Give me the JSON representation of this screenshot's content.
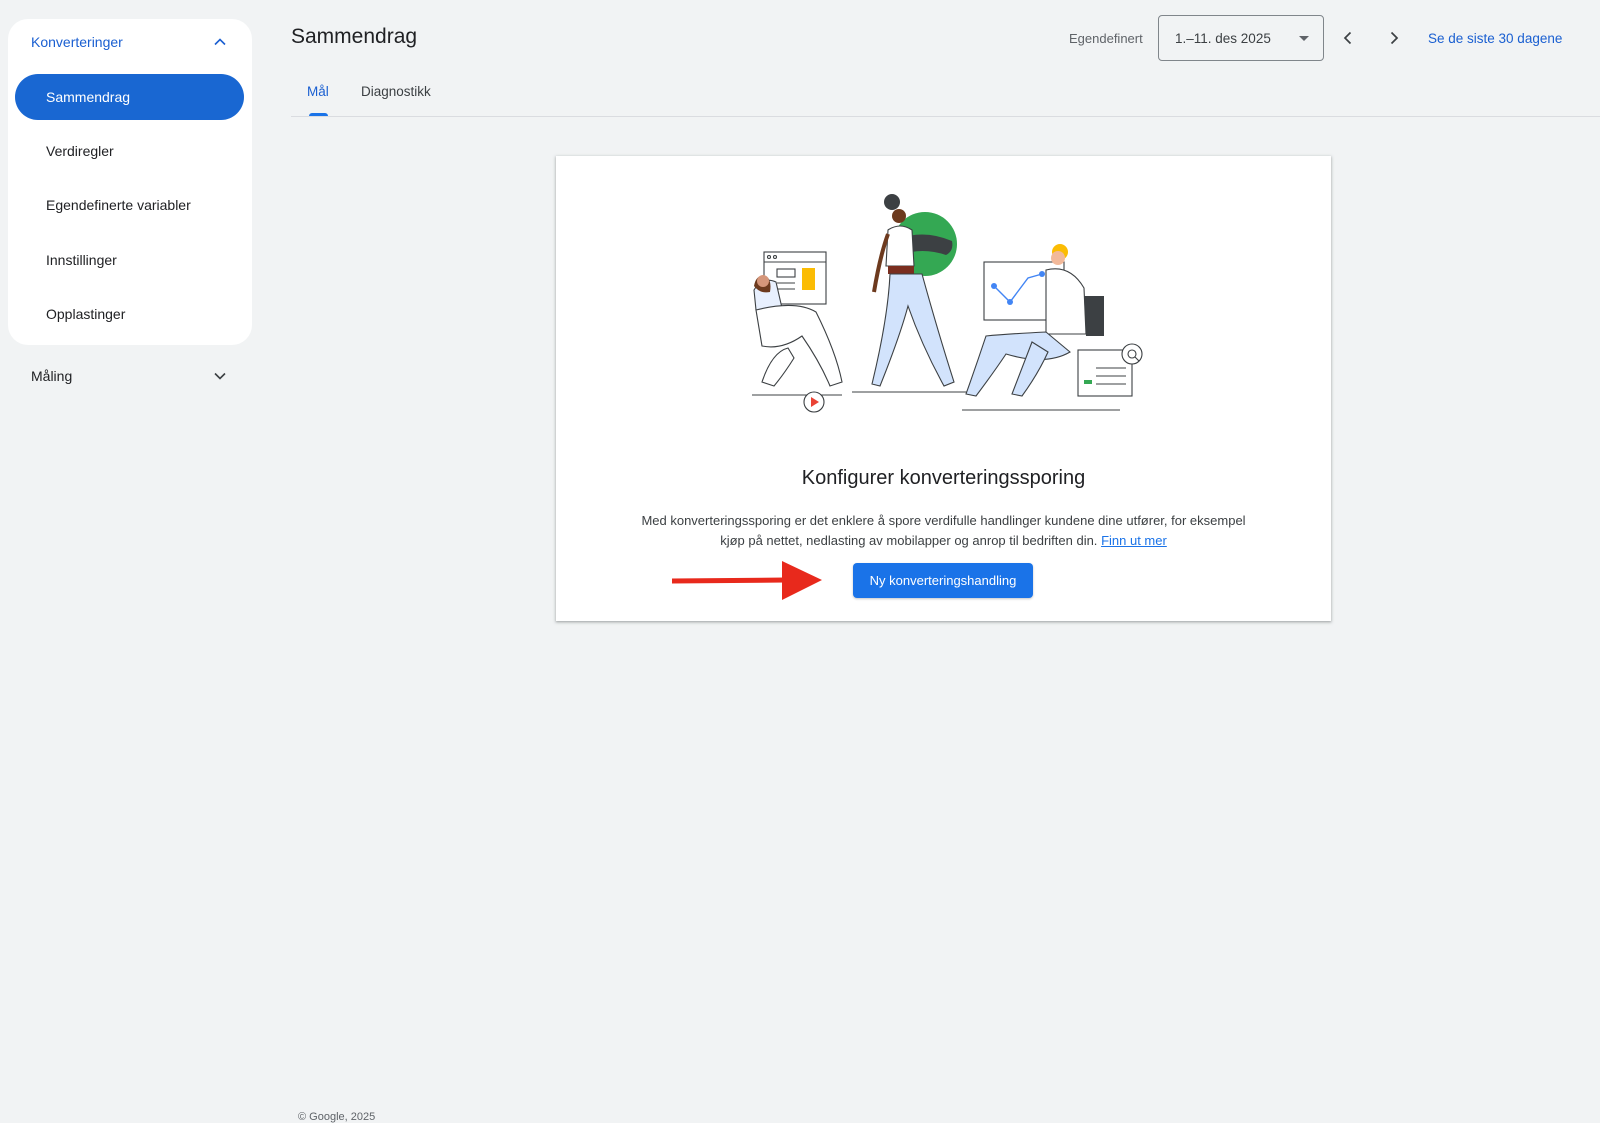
{
  "sidebar": {
    "group": {
      "label": "Konverteringer",
      "expanded": true
    },
    "items": [
      {
        "label": "Sammendrag",
        "active": true
      },
      {
        "label": "Verdiregler",
        "active": false
      },
      {
        "label": "Egendefinerte variabler",
        "active": false
      },
      {
        "label": "Innstillinger",
        "active": false
      },
      {
        "label": "Opplastinger",
        "active": false
      }
    ],
    "collapsed_group": {
      "label": "Måling",
      "expanded": false
    }
  },
  "header": {
    "title": "Sammendrag",
    "date_range_label": "Egendefinert",
    "date_range_value": "1.–11. des 2025",
    "last_30_link": "Se de siste 30 dagene"
  },
  "tabs": [
    {
      "label": "Mål",
      "active": true
    },
    {
      "label": "Diagnostikk",
      "active": false
    }
  ],
  "card": {
    "title": "Konfigurer konverteringssporing",
    "description": "Med konverteringssporing er det enklere å spore verdifulle handlinger kundene dine utfører, for eksempel kjøp på nettet, nedlasting av mobilapper og anrop til bedriften din.",
    "learn_more": "Finn ut mer",
    "primary_button": "Ny konverteringshandling"
  },
  "footer": {
    "copyright": "© Google, 2025"
  },
  "colors": {
    "accent": "#1a73e8",
    "active_nav": "#1967d2",
    "background": "#f1f3f4",
    "annotation_arrow": "#e8291c"
  }
}
